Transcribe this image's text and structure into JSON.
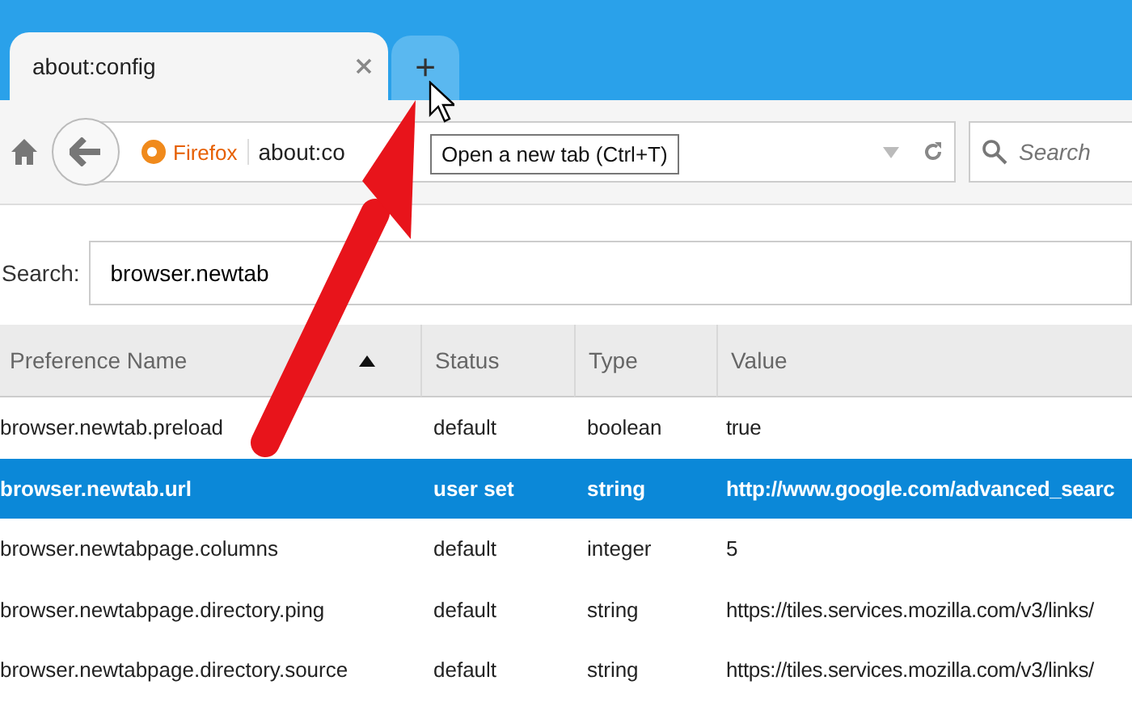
{
  "tabs": [
    {
      "label": "about:config",
      "selected": true
    }
  ],
  "new_tab_button": {
    "label": "+"
  },
  "tooltip": {
    "text": "Open a new tab (Ctrl+T)"
  },
  "address_bar": {
    "identity": "Firefox",
    "value": "about:co"
  },
  "search_box": {
    "placeholder": "Search"
  },
  "filter": {
    "label": "Search:",
    "value": "browser.newtab"
  },
  "table": {
    "columns": [
      {
        "label": "Preference Name",
        "sorted": true
      },
      {
        "label": "Status",
        "sorted": false
      },
      {
        "label": "Type",
        "sorted": false
      },
      {
        "label": "Value",
        "sorted": false
      }
    ],
    "rows": [
      {
        "name": "browser.newtab.preload",
        "status": "default",
        "type": "boolean",
        "value": "true",
        "selected": false,
        "modified": false
      },
      {
        "name": "browser.newtab.url",
        "status": "user set",
        "type": "string",
        "value": "http://www.google.com/advanced_searc",
        "selected": true,
        "modified": true
      },
      {
        "name": "browser.newtabpage.columns",
        "status": "default",
        "type": "integer",
        "value": "5",
        "selected": false,
        "modified": false
      },
      {
        "name": "browser.newtabpage.directory.ping",
        "status": "default",
        "type": "string",
        "value": "https://tiles.services.mozilla.com/v3/links/",
        "selected": false,
        "modified": false
      },
      {
        "name": "browser.newtabpage.directory.source",
        "status": "default",
        "type": "string",
        "value": "https://tiles.services.mozilla.com/v3/links/",
        "selected": false,
        "modified": false
      }
    ]
  }
}
